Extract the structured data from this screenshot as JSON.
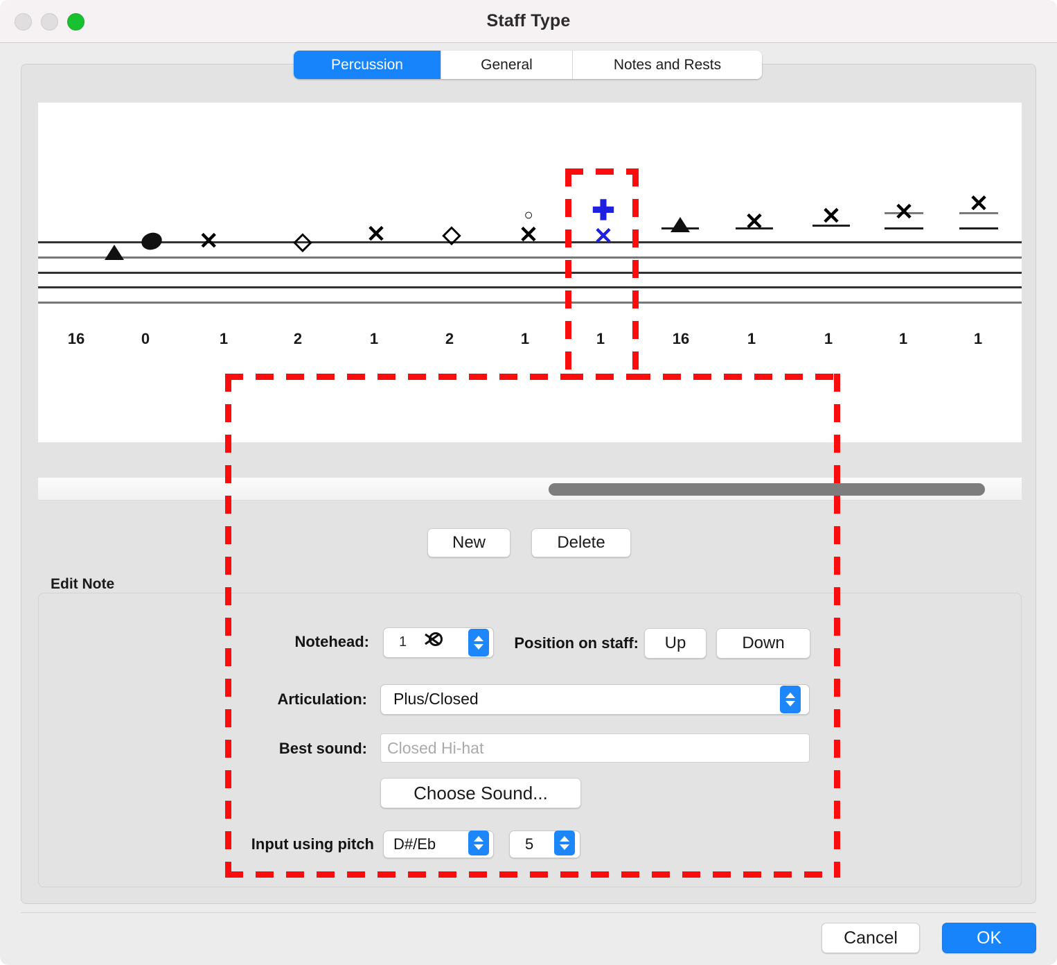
{
  "window": {
    "title": "Staff Type",
    "traffic_lights": [
      "close-button",
      "minimize-button",
      "zoom-button"
    ]
  },
  "tabs": [
    {
      "label": "Percussion",
      "active": true
    },
    {
      "label": "General",
      "active": false
    },
    {
      "label": "Notes and Rests",
      "active": false
    }
  ],
  "staff_preview": {
    "notes": [
      {
        "index": 1,
        "number": "16",
        "glyph": "triangle-up",
        "selected": false
      },
      {
        "index": 2,
        "number": "0",
        "glyph": "oval-filled",
        "selected": false
      },
      {
        "index": 3,
        "number": "1",
        "glyph": "x",
        "selected": false
      },
      {
        "index": 4,
        "number": "2",
        "glyph": "diamond",
        "selected": false
      },
      {
        "index": 5,
        "number": "1",
        "glyph": "x",
        "selected": false
      },
      {
        "index": 6,
        "number": "2",
        "glyph": "diamond",
        "selected": false
      },
      {
        "index": 7,
        "number": "1",
        "glyph": "x-with-circle",
        "selected": false
      },
      {
        "index": 8,
        "number": "1",
        "glyph": "x-with-plus",
        "selected": true
      },
      {
        "index": 9,
        "number": "16",
        "glyph": "triangle-up",
        "selected": false
      },
      {
        "index": 10,
        "number": "1",
        "glyph": "x",
        "selected": false
      },
      {
        "index": 11,
        "number": "1",
        "glyph": "x",
        "selected": false
      },
      {
        "index": 12,
        "number": "1",
        "glyph": "x",
        "selected": false
      },
      {
        "index": 13,
        "number": "1",
        "glyph": "x",
        "selected": false
      }
    ],
    "numbers_row": [
      "16",
      "0",
      "1",
      "2",
      "1",
      "2",
      "1",
      "1",
      "16",
      "1",
      "1",
      "1",
      "1"
    ],
    "selected_color": "#2020e0",
    "highlight_color": "#fc0d0d"
  },
  "scrollbar": {
    "name": "horizontal-scrollbar"
  },
  "actions": {
    "new_label": "New",
    "delete_label": "Delete"
  },
  "edit_note": {
    "group_label": "Edit Note",
    "notehead_label": "Notehead:",
    "notehead_value": "1",
    "notehead_glyph": "x-with-circle",
    "position_label": "Position on staff:",
    "up_label": "Up",
    "down_label": "Down",
    "articulation_label": "Articulation:",
    "articulation_value": "Plus/Closed",
    "best_sound_label": "Best sound:",
    "best_sound_placeholder": "Closed Hi-hat",
    "choose_sound_label": "Choose Sound...",
    "input_pitch_label": "Input using pitch",
    "pitch_value": "D#/Eb",
    "octave_value": "5"
  },
  "footer": {
    "cancel_label": "Cancel",
    "ok_label": "OK",
    "ok_color": "#1784fc"
  }
}
